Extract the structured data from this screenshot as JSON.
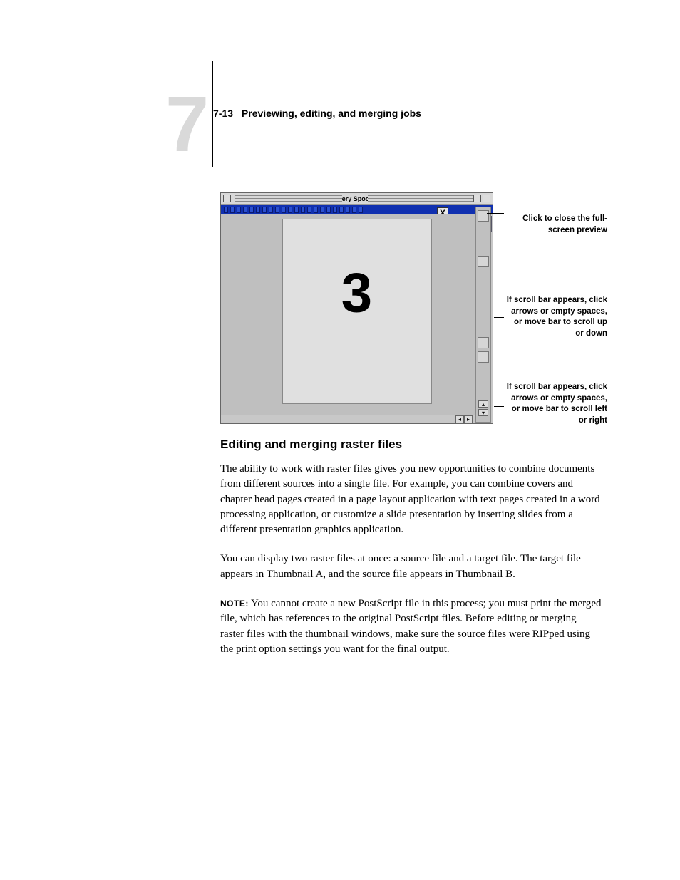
{
  "header": {
    "chapter_number": "7",
    "page_number": "7-13",
    "section_title": "Previewing, editing, and merging jobs"
  },
  "figure": {
    "window_title": "Fiery Spooler",
    "preview_page_number": "3",
    "close_glyph": "X",
    "callouts": {
      "close": "Click to close the full-screen preview",
      "vscroll": "If scroll bar appears, click arrows or empty spaces, or move bar to scroll up or down",
      "hscroll": "If scroll bar appears, click arrows or empty spaces, or move bar to scroll left or right"
    }
  },
  "content": {
    "section_heading": "Editing and merging raster files",
    "para1": "The ability to work with raster files gives you new opportunities to combine documents from different sources into a single file. For example, you can combine covers and chapter head pages created in a page layout application with text pages created in a word processing application, or customize a slide presentation by inserting slides from a different presentation graphics application.",
    "para2": "You can display two raster files at once: a source file and a target file. The target file appears in Thumbnail A, and the source file appears in Thumbnail B.",
    "note_label": "NOTE:",
    "para3": "You cannot create a new PostScript file in this process; you must print the merged file, which has references to the original PostScript files. Before editing or merging raster files with the thumbnail windows, make sure the source files were RIPped using the print option settings you want for the final output."
  }
}
